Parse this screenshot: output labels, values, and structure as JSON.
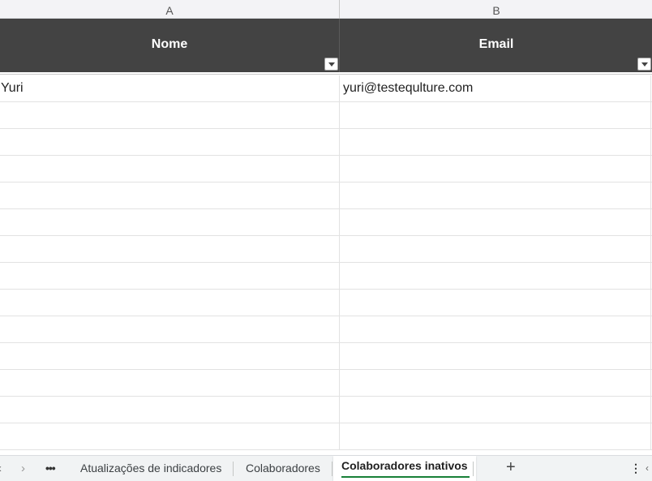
{
  "columns": {
    "a": "A",
    "b": "B"
  },
  "table": {
    "headers": [
      "Nome",
      "Email"
    ],
    "rows": [
      [
        "Yuri",
        "yuri@testequlture.com"
      ],
      [
        "",
        ""
      ],
      [
        "",
        ""
      ],
      [
        "",
        ""
      ],
      [
        "",
        ""
      ],
      [
        "",
        ""
      ],
      [
        "",
        ""
      ],
      [
        "",
        ""
      ],
      [
        "",
        ""
      ],
      [
        "",
        ""
      ],
      [
        "",
        ""
      ],
      [
        "",
        ""
      ],
      [
        "",
        ""
      ],
      [
        "",
        ""
      ]
    ]
  },
  "tabs_bar": {
    "prev_icon": "‹",
    "next_icon": "›",
    "more_icon": "•••",
    "tabs": [
      "Atualizações de indicadores",
      "Colaboradores",
      "Colaboradores inativos"
    ],
    "active_tab": "Colaboradores inativos",
    "add_icon": "+",
    "menu_icon": "⋮",
    "scroll_icon": "‹"
  },
  "colors": {
    "header_bg": "#434343",
    "header_text": "#ffffff",
    "active_tab_accent": "#188038"
  }
}
